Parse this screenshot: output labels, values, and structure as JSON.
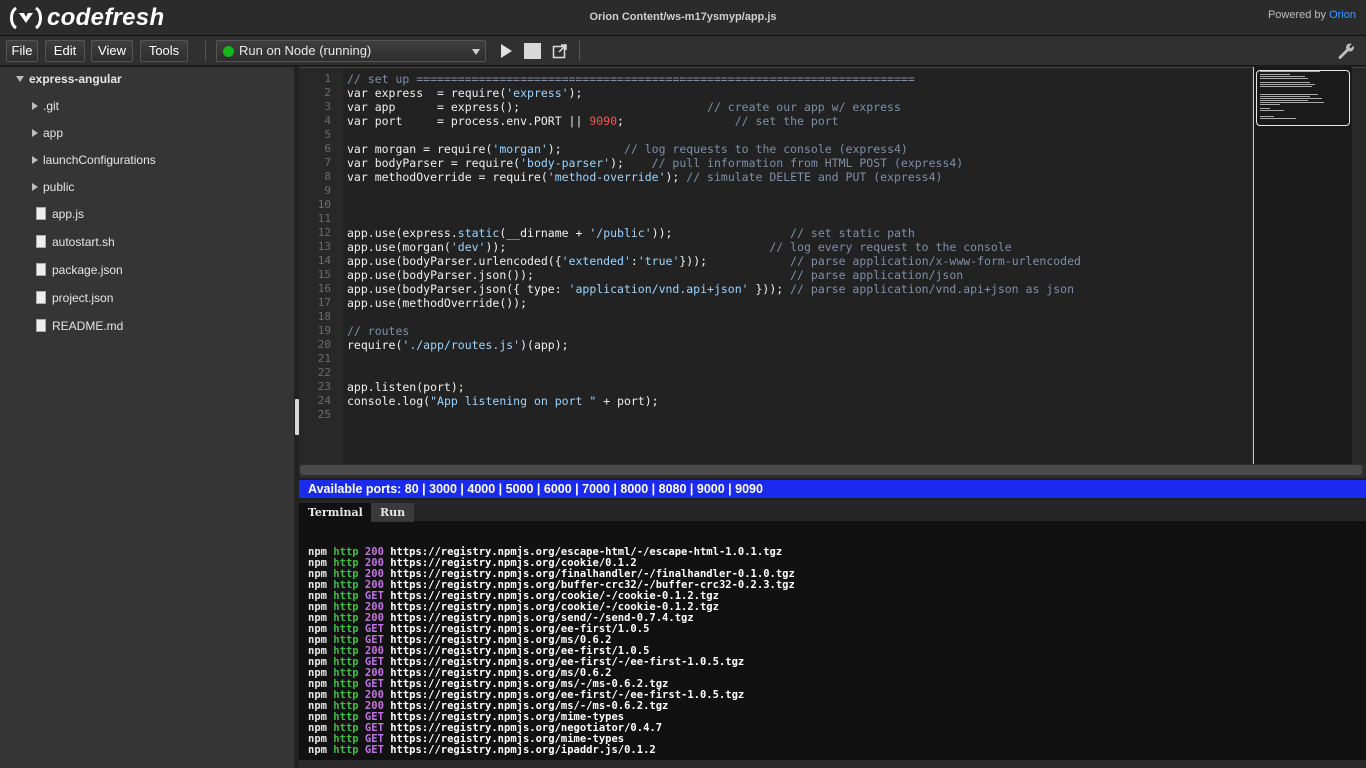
{
  "app": {
    "brand": "codefresh",
    "title": "Orion Content/ws-m17ysmyp/app.js",
    "powered_prefix": "Powered by",
    "powered_brand": "Orion"
  },
  "menu": {
    "file": "File",
    "edit": "Edit",
    "view": "View",
    "tools": "Tools",
    "run_selector": "Run on Node (running)"
  },
  "icons": {
    "play": "play-icon",
    "stop": "stop-icon",
    "external": "external-link-icon",
    "settings": "wrench-icon"
  },
  "sidebar": {
    "root": "express-angular",
    "items": [
      {
        "label": ".git",
        "type": "folder"
      },
      {
        "label": "app",
        "type": "folder"
      },
      {
        "label": "launchConfigurations",
        "type": "folder"
      },
      {
        "label": "public",
        "type": "folder"
      },
      {
        "label": "app.js",
        "type": "file"
      },
      {
        "label": "autostart.sh",
        "type": "file"
      },
      {
        "label": "package.json",
        "type": "file"
      },
      {
        "label": "project.json",
        "type": "file"
      },
      {
        "label": "README.md",
        "type": "file"
      }
    ]
  },
  "editor": {
    "line_numbers": [
      "1",
      "2",
      "3",
      "4",
      "5",
      "6",
      "7",
      "8",
      "9",
      "10",
      "11",
      "12",
      "13",
      "14",
      "15",
      "16",
      "17",
      "18",
      "19",
      "20",
      "21",
      "22",
      "23",
      "24",
      "25"
    ],
    "lines": [
      [
        {
          "t": "c",
          "v": "// set up ========================================================================"
        }
      ],
      [
        {
          "t": "k",
          "v": "var express  = require("
        },
        {
          "t": "s",
          "v": "'express'"
        },
        {
          "t": "k",
          "v": ");"
        }
      ],
      [
        {
          "t": "k",
          "v": "var app      = express();                           "
        },
        {
          "t": "c",
          "v": "// create our app w/ express"
        }
      ],
      [
        {
          "t": "k",
          "v": "var port     = process.env.PORT || "
        },
        {
          "t": "n",
          "v": "9090"
        },
        {
          "t": "k",
          "v": ";                "
        },
        {
          "t": "c",
          "v": "// set the port"
        }
      ],
      [],
      [
        {
          "t": "k",
          "v": "var morgan = require("
        },
        {
          "t": "s",
          "v": "'morgan'"
        },
        {
          "t": "k",
          "v": ");         "
        },
        {
          "t": "c",
          "v": "// log requests to the console (express4)"
        }
      ],
      [
        {
          "t": "k",
          "v": "var bodyParser = require("
        },
        {
          "t": "s",
          "v": "'body-parser'"
        },
        {
          "t": "k",
          "v": ");    "
        },
        {
          "t": "c",
          "v": "// pull information from HTML POST (express4)"
        }
      ],
      [
        {
          "t": "k",
          "v": "var methodOverride = require("
        },
        {
          "t": "s",
          "v": "'method-override'"
        },
        {
          "t": "k",
          "v": "); "
        },
        {
          "t": "c",
          "v": "// simulate DELETE and PUT (express4)"
        }
      ],
      [],
      [],
      [],
      [
        {
          "t": "k",
          "v": "app.use(express."
        },
        {
          "t": "s",
          "v": "static"
        },
        {
          "t": "k",
          "v": "(__dirname + "
        },
        {
          "t": "s",
          "v": "'/public'"
        },
        {
          "t": "k",
          "v": "));                 "
        },
        {
          "t": "c",
          "v": "// set static path"
        }
      ],
      [
        {
          "t": "k",
          "v": "app.use(morgan("
        },
        {
          "t": "s",
          "v": "'dev'"
        },
        {
          "t": "k",
          "v": "));                                      "
        },
        {
          "t": "c",
          "v": "// log every request to the console"
        }
      ],
      [
        {
          "t": "k",
          "v": "app.use(bodyParser.urlencoded({"
        },
        {
          "t": "s",
          "v": "'extended'"
        },
        {
          "t": "k",
          "v": ":"
        },
        {
          "t": "s",
          "v": "'true'"
        },
        {
          "t": "k",
          "v": "}));            "
        },
        {
          "t": "c",
          "v": "// parse application/x-www-form-urlencoded"
        }
      ],
      [
        {
          "t": "k",
          "v": "app.use(bodyParser.json());                                     "
        },
        {
          "t": "c",
          "v": "// parse application/json"
        }
      ],
      [
        {
          "t": "k",
          "v": "app.use(bodyParser.json({ type: "
        },
        {
          "t": "s",
          "v": "'application/vnd.api+json'"
        },
        {
          "t": "k",
          "v": " })); "
        },
        {
          "t": "c",
          "v": "// parse application/vnd.api+json as json"
        }
      ],
      [
        {
          "t": "k",
          "v": "app.use(methodOverride());"
        }
      ],
      [],
      [
        {
          "t": "c",
          "v": "// routes"
        }
      ],
      [
        {
          "t": "k",
          "v": "require("
        },
        {
          "t": "s",
          "v": "'./app/routes.js'"
        },
        {
          "t": "k",
          "v": ")(app);"
        }
      ],
      [],
      [],
      [
        {
          "t": "k",
          "v": "app.listen(port);"
        }
      ],
      [
        {
          "t": "k",
          "v": "console.log("
        },
        {
          "t": "s",
          "v": "\"App listening on port \""
        },
        {
          "t": "k",
          "v": " + port);"
        }
      ],
      []
    ]
  },
  "ports_bar": "Available ports: 80 | 3000 | 4000 | 5000 | 6000 | 7000 | 8000 | 8080 | 9000 | 9090",
  "tabs": {
    "terminal": "Terminal",
    "run": "Run"
  },
  "terminal": {
    "lines": [
      {
        "npm": "npm",
        "proto": "http",
        "code": "200",
        "url": "https://registry.npmjs.org/escape-html/-/escape-html-1.0.1.tgz"
      },
      {
        "npm": "npm",
        "proto": "http",
        "code": "200",
        "url": "https://registry.npmjs.org/cookie/0.1.2"
      },
      {
        "npm": "npm",
        "proto": "http",
        "code": "200",
        "url": "https://registry.npmjs.org/finalhandler/-/finalhandler-0.1.0.tgz"
      },
      {
        "npm": "npm",
        "proto": "http",
        "code": "200",
        "url": "https://registry.npmjs.org/buffer-crc32/-/buffer-crc32-0.2.3.tgz"
      },
      {
        "npm": "npm",
        "proto": "http",
        "code": "GET",
        "url": "https://registry.npmjs.org/cookie/-/cookie-0.1.2.tgz"
      },
      {
        "npm": "npm",
        "proto": "http",
        "code": "200",
        "url": "https://registry.npmjs.org/cookie/-/cookie-0.1.2.tgz"
      },
      {
        "npm": "npm",
        "proto": "http",
        "code": "200",
        "url": "https://registry.npmjs.org/send/-/send-0.7.4.tgz"
      },
      {
        "npm": "npm",
        "proto": "http",
        "code": "GET",
        "url": "https://registry.npmjs.org/ee-first/1.0.5"
      },
      {
        "npm": "npm",
        "proto": "http",
        "code": "GET",
        "url": "https://registry.npmjs.org/ms/0.6.2"
      },
      {
        "npm": "npm",
        "proto": "http",
        "code": "200",
        "url": "https://registry.npmjs.org/ee-first/1.0.5"
      },
      {
        "npm": "npm",
        "proto": "http",
        "code": "GET",
        "url": "https://registry.npmjs.org/ee-first/-/ee-first-1.0.5.tgz"
      },
      {
        "npm": "npm",
        "proto": "http",
        "code": "200",
        "url": "https://registry.npmjs.org/ms/0.6.2"
      },
      {
        "npm": "npm",
        "proto": "http",
        "code": "GET",
        "url": "https://registry.npmjs.org/ms/-/ms-0.6.2.tgz"
      },
      {
        "npm": "npm",
        "proto": "http",
        "code": "200",
        "url": "https://registry.npmjs.org/ee-first/-/ee-first-1.0.5.tgz"
      },
      {
        "npm": "npm",
        "proto": "http",
        "code": "200",
        "url": "https://registry.npmjs.org/ms/-/ms-0.6.2.tgz"
      },
      {
        "npm": "npm",
        "proto": "http",
        "code": "GET",
        "url": "https://registry.npmjs.org/mime-types"
      },
      {
        "npm": "npm",
        "proto": "http",
        "code": "GET",
        "url": "https://registry.npmjs.org/negotiator/0.4.7"
      },
      {
        "npm": "npm",
        "proto": "http",
        "code": "GET",
        "url": "https://registry.npmjs.org/mime-types"
      },
      {
        "npm": "npm",
        "proto": "http",
        "code": "GET",
        "url": "https://registry.npmjs.org/ipaddr.js/0.1.2"
      }
    ]
  },
  "colors": {
    "accent_blue": "#1a2af0",
    "running_green": "#16b51c",
    "orion_link": "#3b9bff"
  }
}
